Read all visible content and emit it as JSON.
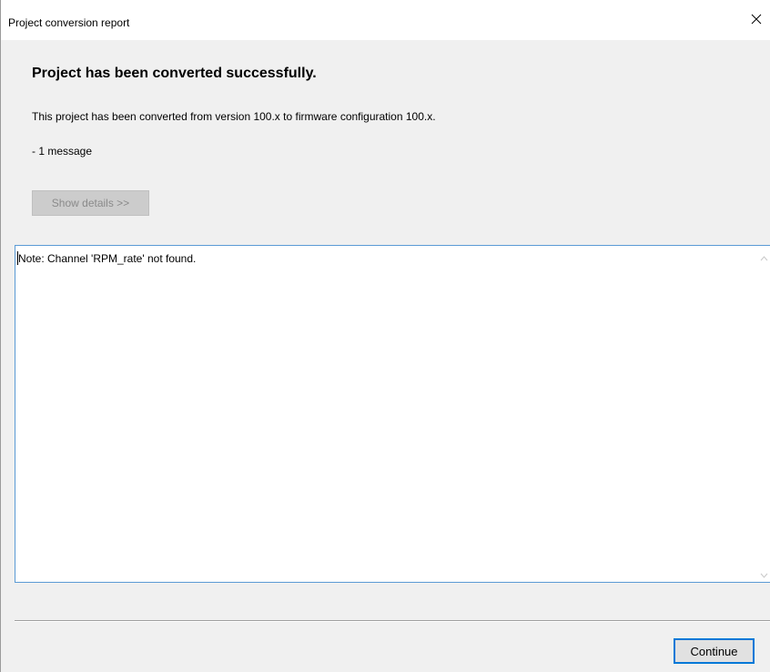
{
  "window": {
    "title": "Project conversion report"
  },
  "report": {
    "heading": "Project has been converted successfully.",
    "description": "This project has been converted from version 100.x to firmware configuration 100.x.",
    "message_count": "- 1 message",
    "details_button_label": "Show details >>",
    "details_button_enabled": false
  },
  "log": {
    "lines": [
      "Note: Channel 'RPM_rate' not found."
    ]
  },
  "footer": {
    "continue_label": "Continue"
  },
  "colors": {
    "accent": "#0078d7",
    "focus_border": "#5b9bd5",
    "dialog_bg": "#f0f0f0"
  },
  "icons": {
    "close": "close-icon",
    "scroll_up": "chevron-up-icon",
    "scroll_down": "chevron-down-icon"
  }
}
